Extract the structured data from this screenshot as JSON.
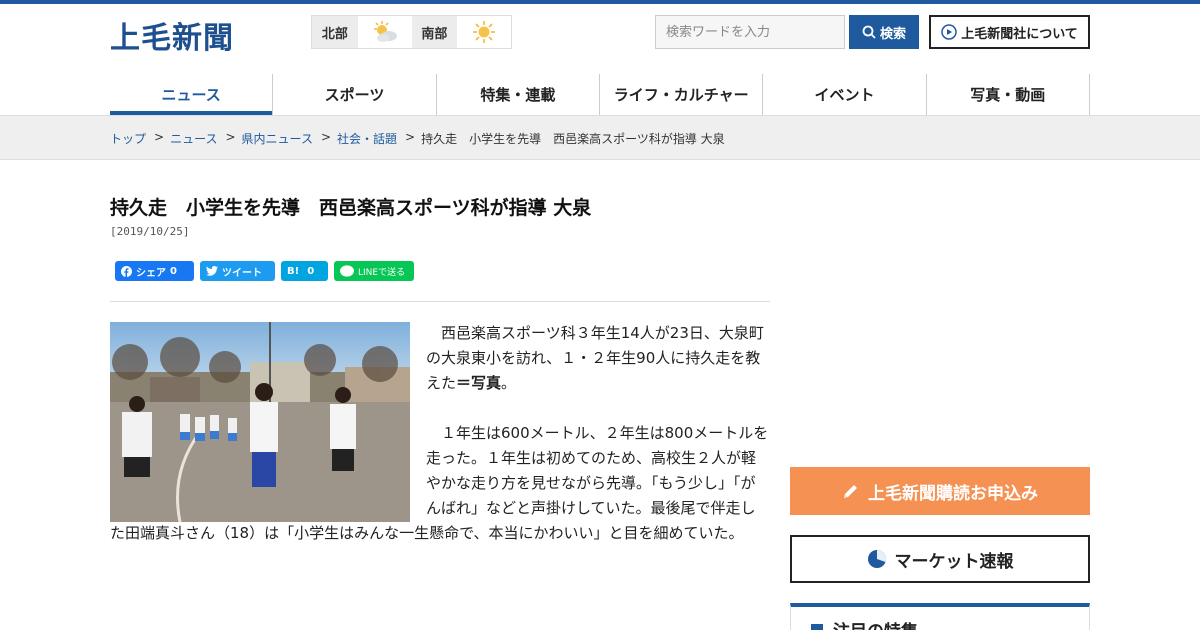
{
  "header": {
    "logo": "上毛新聞",
    "weather": [
      {
        "region": "北部",
        "icon": "sun-cloud-icon"
      },
      {
        "region": "南部",
        "icon": "sun-icon"
      }
    ],
    "search_placeholder": "検索ワードを入力",
    "search_label": "検索",
    "about_label": "上毛新聞社について"
  },
  "nav": {
    "items": [
      {
        "label": "ニュース",
        "active": true
      },
      {
        "label": "スポーツ"
      },
      {
        "label": "特集・連載"
      },
      {
        "label": "ライフ・カルチャー"
      },
      {
        "label": "イベント"
      },
      {
        "label": "写真・動画"
      }
    ]
  },
  "breadcrumb": {
    "items": [
      "トップ",
      "ニュース",
      "県内ニュース",
      "社会・話題"
    ],
    "current": "持久走　小学生を先導　西邑楽高スポーツ科が指導 大泉",
    "separator": ">"
  },
  "article": {
    "headline": "持久走　小学生を先導　西邑楽高スポーツ科が指導 大泉",
    "date": "[2019/10/25]",
    "share": {
      "facebook": "シェア",
      "facebook_count": "0",
      "twitter": "ツイート",
      "hatena": "B!",
      "hatena_count": "0",
      "line": "LINEで送る"
    },
    "para1": "西邑楽高スポーツ科３年生14人が23日、大泉町の大泉東小を訪れ、１・２年生90人に持久走を教えた",
    "para1_bold": "＝写真",
    "para1_end": "。",
    "para2": "１年生は600メートル、２年生は800メートルを走った。１年生は初めてのため、高校生２人が軽やかな走り方を見せながら先導。「もう少し」「がんばれ」などと声掛けしていた。最後尾で伴走した田端真斗さん（18）は「小学生はみんな一生懸命で、本当にかわいい」と目を細めていた。"
  },
  "sidebar": {
    "subscribe_label": "上毛新聞購読お申込み",
    "market_label": "マーケット速報",
    "feature_title": "注目の特集"
  },
  "colors": {
    "brand": "#1f5a9e",
    "subscribe": "#f59153"
  }
}
